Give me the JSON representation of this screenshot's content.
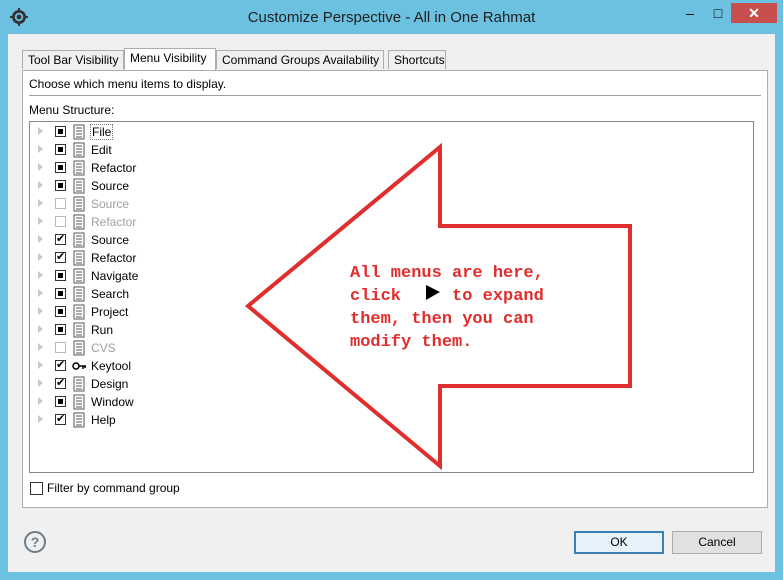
{
  "window": {
    "title": "Customize Perspective - All in One Rahmat",
    "min_label": "–",
    "max_label": "□",
    "close_label": "✕"
  },
  "tabs": [
    {
      "label": "Tool Bar Visibility",
      "active": false
    },
    {
      "label": "Menu Visibility",
      "active": true
    },
    {
      "label": "Command Groups Availability",
      "active": false
    },
    {
      "label": "Shortcuts",
      "active": false
    }
  ],
  "panel": {
    "description": "Choose which menu items to display.",
    "structure_label": "Menu Structure:"
  },
  "menu_items": [
    {
      "label": "File",
      "state": "partial",
      "enabled": true,
      "icon": "menu-icon"
    },
    {
      "label": "Edit",
      "state": "partial",
      "enabled": true,
      "icon": "menu-icon"
    },
    {
      "label": "Refactor",
      "state": "partial",
      "enabled": true,
      "icon": "menu-icon"
    },
    {
      "label": "Source",
      "state": "partial",
      "enabled": true,
      "icon": "menu-icon"
    },
    {
      "label": "Source",
      "state": "unchecked",
      "enabled": false,
      "icon": "menu-icon"
    },
    {
      "label": "Refactor",
      "state": "unchecked",
      "enabled": false,
      "icon": "menu-icon"
    },
    {
      "label": "Source",
      "state": "checked",
      "enabled": true,
      "icon": "menu-icon"
    },
    {
      "label": "Refactor",
      "state": "checked",
      "enabled": true,
      "icon": "menu-icon"
    },
    {
      "label": "Navigate",
      "state": "partial",
      "enabled": true,
      "icon": "menu-icon"
    },
    {
      "label": "Search",
      "state": "partial",
      "enabled": true,
      "icon": "menu-icon"
    },
    {
      "label": "Project",
      "state": "partial",
      "enabled": true,
      "icon": "menu-icon"
    },
    {
      "label": "Run",
      "state": "partial",
      "enabled": true,
      "icon": "menu-icon"
    },
    {
      "label": "CVS",
      "state": "unchecked",
      "enabled": false,
      "icon": "menu-icon"
    },
    {
      "label": "Keytool",
      "state": "checked",
      "enabled": true,
      "icon": "key-icon"
    },
    {
      "label": "Design",
      "state": "checked",
      "enabled": true,
      "icon": "menu-icon"
    },
    {
      "label": "Window",
      "state": "partial",
      "enabled": true,
      "icon": "menu-icon"
    },
    {
      "label": "Help",
      "state": "checked",
      "enabled": true,
      "icon": "menu-icon"
    }
  ],
  "filter": {
    "label": "Filter by command group",
    "checked": false
  },
  "buttons": {
    "ok": "OK",
    "cancel": "Cancel",
    "help": "?"
  },
  "annotation": {
    "lines": [
      "All menus are here,",
      "click     to expand",
      "them, then you can",
      "modify them."
    ],
    "arrow_color": "#e02d2d"
  },
  "colors": {
    "titlebar": "#6cc0e0",
    "close": "#c7504f",
    "annotation_text": "#e02d2d"
  }
}
